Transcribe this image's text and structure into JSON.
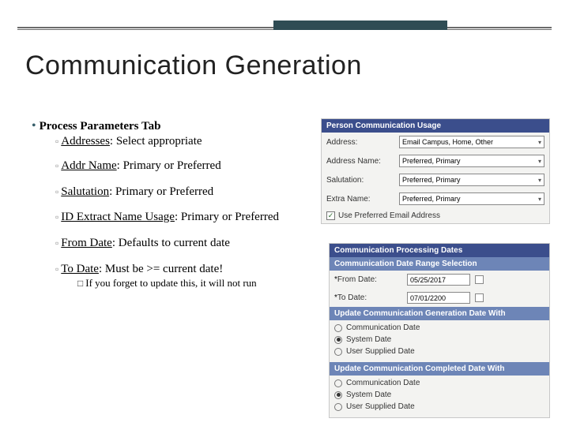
{
  "title": "Communication Generation",
  "bullets": {
    "main": "Process Parameters Tab",
    "items": [
      {
        "label": "Addresses",
        "text": "Select appropriate"
      },
      {
        "label": "Addr Name",
        "text": "Primary or Preferred"
      },
      {
        "label": "Salutation",
        "text": "Primary or Preferred"
      },
      {
        "label": "ID Extract Name Usage",
        "text": "Primary or Preferred"
      },
      {
        "label": "From Date",
        "text": "Defaults to current date"
      },
      {
        "label": "To Date",
        "text": "Must be >= current date!"
      }
    ],
    "note": "If you forget to update this, it will not run"
  },
  "usagePanel": {
    "header": "Person Communication Usage",
    "rows": {
      "address": {
        "label": "Address:",
        "value": "Email Campus, Home, Other"
      },
      "addressName": {
        "label": "Address Name:",
        "value": "Preferred, Primary"
      },
      "salutation": {
        "label": "Salutation:",
        "value": "Preferred, Primary"
      },
      "extraName": {
        "label": "Extra Name:",
        "value": "Preferred, Primary"
      }
    },
    "checkbox": "Use Preferred Email Address"
  },
  "datesPanel": {
    "header": "Communication Processing Dates",
    "rangeHeader": "Communication Date Range Selection",
    "from": {
      "label": "From Date:",
      "value": "05/25/2017"
    },
    "to": {
      "label": "To Date:",
      "value": "07/01/2200"
    },
    "updateGenHeader": "Update Communication Generation Date With",
    "updateCompHeader": "Update Communication Completed Date With",
    "options": {
      "comm": "Communication Date",
      "sys": "System Date",
      "user": "User Supplied Date"
    }
  }
}
